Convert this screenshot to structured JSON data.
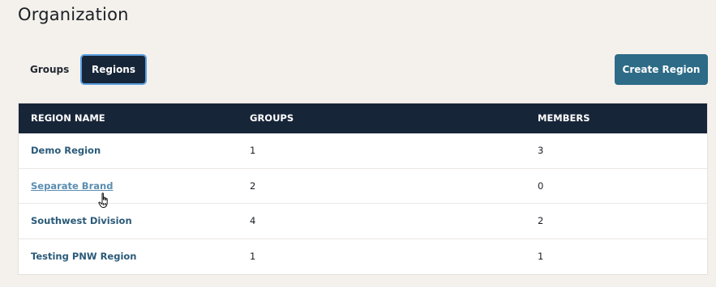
{
  "page": {
    "title": "Organization"
  },
  "tabs": [
    {
      "label": "Groups",
      "active": false
    },
    {
      "label": "Regions",
      "active": true
    }
  ],
  "actions": {
    "create_label": "Create Region"
  },
  "table": {
    "headers": [
      "REGION NAME",
      "GROUPS",
      "MEMBERS"
    ],
    "rows": [
      {
        "name": "Demo Region",
        "groups": "1",
        "members": "3"
      },
      {
        "name": "Separate Brand",
        "groups": "2",
        "members": "0"
      },
      {
        "name": "Southwest Division",
        "groups": "4",
        "members": "2"
      },
      {
        "name": "Testing PNW Region",
        "groups": "1",
        "members": "1"
      }
    ]
  },
  "colors": {
    "background": "#f4f0eb",
    "header_bg": "#172538",
    "accent": "#2d6b87",
    "link": "#2a5a78"
  },
  "icons": {
    "cursor": "hand-pointer-icon"
  }
}
